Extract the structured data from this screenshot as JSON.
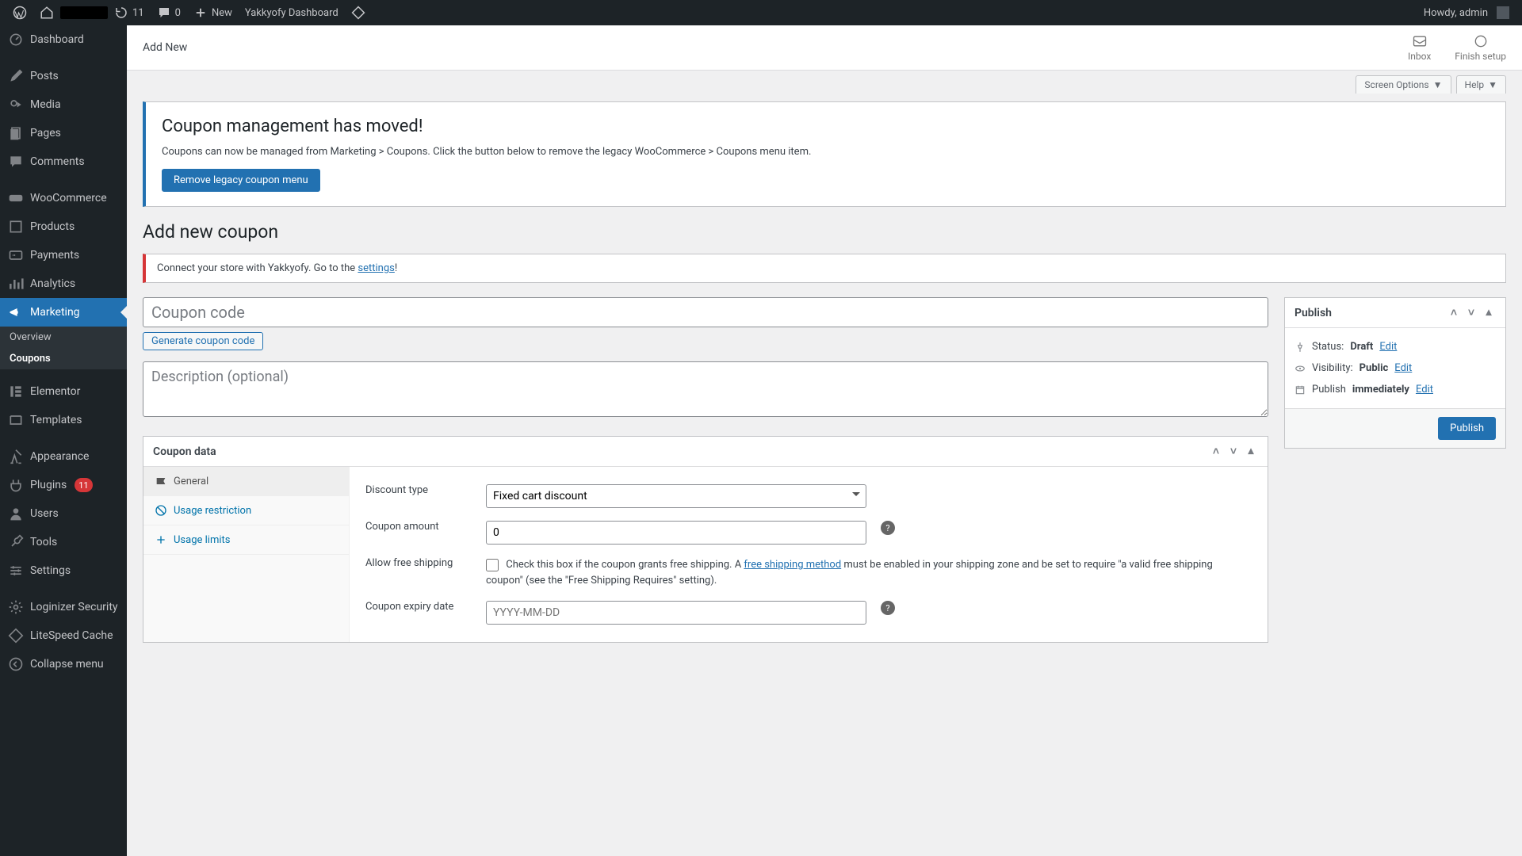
{
  "adminbar": {
    "updates_count": "11",
    "comments_count": "0",
    "new_label": "New",
    "dashboard_link": "Yakkyofy Dashboard",
    "howdy": "Howdy, admin"
  },
  "sidebar": {
    "items": [
      {
        "label": "Dashboard"
      },
      {
        "label": "Posts"
      },
      {
        "label": "Media"
      },
      {
        "label": "Pages"
      },
      {
        "label": "Comments"
      },
      {
        "label": "WooCommerce"
      },
      {
        "label": "Products"
      },
      {
        "label": "Payments"
      },
      {
        "label": "Analytics"
      },
      {
        "label": "Marketing"
      },
      {
        "label": "Elementor"
      },
      {
        "label": "Templates"
      },
      {
        "label": "Appearance"
      },
      {
        "label": "Plugins"
      },
      {
        "label": "Users"
      },
      {
        "label": "Tools"
      },
      {
        "label": "Settings"
      },
      {
        "label": "Loginizer Security"
      },
      {
        "label": "LiteSpeed Cache"
      },
      {
        "label": "Collapse menu"
      }
    ],
    "plugins_badge": "11",
    "submenu": {
      "overview": "Overview",
      "coupons": "Coupons"
    }
  },
  "topstrip": {
    "title": "Add New",
    "inbox": "Inbox",
    "finish": "Finish setup"
  },
  "tabs": {
    "screen_options": "Screen Options",
    "help": "Help"
  },
  "notice": {
    "title": "Coupon management has moved!",
    "body": "Coupons can now be managed from Marketing > Coupons. Click the button below to remove the legacy WooCommerce > Coupons menu item.",
    "button": "Remove legacy coupon menu"
  },
  "page_title": "Add new coupon",
  "alert": {
    "text_before": "Connect your store with Yakkyofy. Go to the ",
    "link": "settings",
    "text_after": "!"
  },
  "coupon_code_placeholder": "Coupon code",
  "generate_btn": "Generate coupon code",
  "description_placeholder": "Description (optional)",
  "publish_box": {
    "title": "Publish",
    "status_label": "Status:",
    "status_value": "Draft",
    "edit": "Edit",
    "visibility_label": "Visibility:",
    "visibility_value": "Public",
    "publish_label": "Publish",
    "publish_value": "immediately",
    "button": "Publish"
  },
  "coupon_data": {
    "title": "Coupon data",
    "tabs": {
      "general": "General",
      "usage_restriction": "Usage restriction",
      "usage_limits": "Usage limits"
    },
    "fields": {
      "discount_type_label": "Discount type",
      "discount_type_value": "Fixed cart discount",
      "coupon_amount_label": "Coupon amount",
      "coupon_amount_value": "0",
      "allow_free_shipping_label": "Allow free shipping",
      "allow_free_shipping_text_before": "Check this box if the coupon grants free shipping. A ",
      "allow_free_shipping_link": "free shipping method",
      "allow_free_shipping_text_after": " must be enabled in your shipping zone and be set to require \"a valid free shipping coupon\" (see the \"Free Shipping Requires\" setting).",
      "expiry_label": "Coupon expiry date",
      "expiry_placeholder": "YYYY-MM-DD"
    }
  }
}
